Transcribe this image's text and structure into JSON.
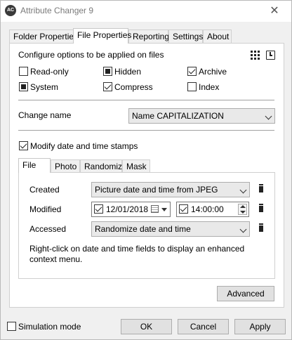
{
  "window": {
    "title": "Attribute Changer 9",
    "icon_text": "AC"
  },
  "tabs": [
    {
      "label": "Folder Properties",
      "active": false
    },
    {
      "label": "File Properties",
      "active": true
    },
    {
      "label": "Reporting",
      "active": false
    },
    {
      "label": "Settings",
      "active": false
    },
    {
      "label": "About",
      "active": false
    }
  ],
  "file_properties": {
    "intro": "Configure options to be applied on files",
    "attributes": [
      {
        "label": "Read-only",
        "state": "unchecked"
      },
      {
        "label": "Hidden",
        "state": "indeterminate"
      },
      {
        "label": "Archive",
        "state": "checked"
      },
      {
        "label": "System",
        "state": "indeterminate"
      },
      {
        "label": "Compress",
        "state": "checked"
      },
      {
        "label": "Index",
        "state": "unchecked"
      }
    ],
    "change_name_label": "Change name",
    "change_name_value": "Name CAPITALIZATION",
    "modify_dates_label": "Modify date and time stamps",
    "modify_dates_checked": true,
    "inner_tabs": [
      {
        "label": "File",
        "active": true
      },
      {
        "label": "Photo",
        "active": false
      },
      {
        "label": "Randomize",
        "active": false
      },
      {
        "label": "Mask",
        "active": false
      }
    ],
    "created_label": "Created",
    "created_value": "Picture date and time from JPEG",
    "modified_label": "Modified",
    "modified_date": "12/01/2018",
    "modified_time": "14:00:00",
    "accessed_label": "Accessed",
    "accessed_value": "Randomize date and time",
    "hint": "Right-click on date and time fields to display an enhanced context menu.",
    "advanced_label": "Advanced"
  },
  "footer": {
    "simulation_label": "Simulation mode",
    "simulation_checked": false,
    "ok_label": "OK",
    "cancel_label": "Cancel",
    "apply_label": "Apply"
  }
}
